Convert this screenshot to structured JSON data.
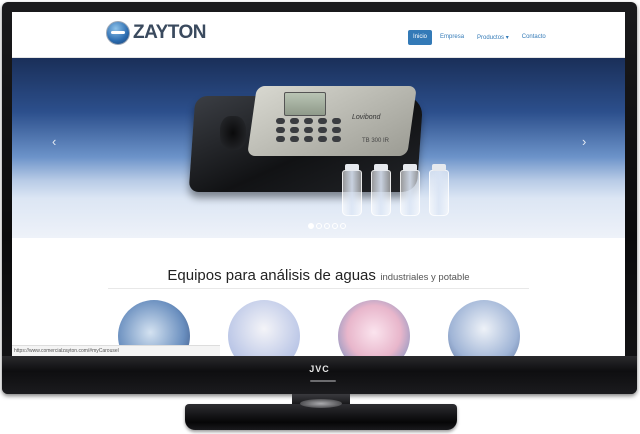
{
  "tv": {
    "brand": "JVC"
  },
  "site": {
    "logo_text": "ZAYTON",
    "nav": [
      {
        "label": "Inicio",
        "active": true
      },
      {
        "label": "Empresa",
        "active": false
      },
      {
        "label": "Productos ▾",
        "active": false
      },
      {
        "label": "Contacto",
        "active": false
      }
    ]
  },
  "carousel": {
    "prev_icon": "chevron-left-icon",
    "next_icon": "chevron-right-icon",
    "device_brand": "Lovibond",
    "device_model": "TB 300 IR",
    "indicator_count": 5,
    "active_indicator": 1
  },
  "section": {
    "title_main": "Equipos para análisis de aguas",
    "title_sub": "industriales y potable"
  },
  "status_bar": {
    "url": "https://www.comercialzayton.com/#myCarousel"
  }
}
